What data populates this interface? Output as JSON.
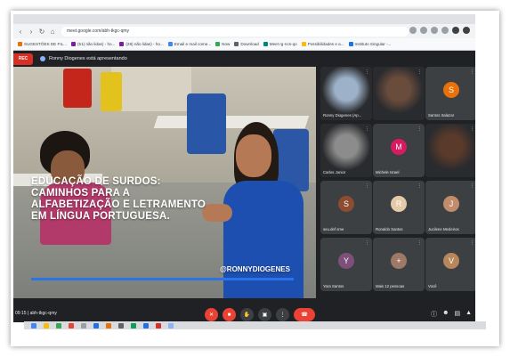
{
  "browser": {
    "url": "meet.google.com/abh-tkgc-qmy",
    "bookmarks": [
      {
        "label": "SUGESTÕES DE FIL...",
        "color": "#e8710a"
      },
      {
        "label": "(51) não lidas) - ho...",
        "color": "#7b1fa2"
      },
      {
        "label": "(28) não lidas) - ho...",
        "color": "#7b1fa2"
      },
      {
        "label": "Email e mail come...",
        "color": "#4285f4"
      },
      {
        "label": "Now",
        "color": "#34a853"
      },
      {
        "label": "Download",
        "color": "#5f6368"
      },
      {
        "label": "Meet rg-ncs-qo",
        "color": "#00897b"
      },
      {
        "label": "Possibilidades e a...",
        "color": "#fbbc04"
      },
      {
        "label": "Instituto Singular -...",
        "color": "#1a73e8"
      }
    ]
  },
  "presentation": {
    "rec_label": "REC",
    "presenter_text": "Ronny Diogenes está apresentando"
  },
  "slide": {
    "title_lines": [
      "EDUCAÇÃO DE SURDOS:",
      "CAMINHOS PARA A",
      "ALFABETIZAÇÃO E LETRAMENTO",
      "EM LÍNGUA PORTUGUESA."
    ],
    "handle": "@RONNYDIOGENES"
  },
  "participants": [
    {
      "name": "Ronny Diogenes (Ap...",
      "type": "photo",
      "color": "#9db2c8",
      "initial": ""
    },
    {
      "name": "",
      "type": "photo",
      "color": "#6a4c3c",
      "initial": ""
    },
    {
      "name": "Santos Salazar",
      "type": "avatar",
      "color": "#e8710a",
      "initial": "S"
    },
    {
      "name": "Carlos Junior",
      "type": "photo",
      "color": "#8c8c8c",
      "initial": ""
    },
    {
      "name": "Michele Israel",
      "type": "avatar",
      "color": "#d81b60",
      "initial": "M"
    },
    {
      "name": "",
      "type": "photo",
      "color": "#5a3a2a",
      "initial": ""
    },
    {
      "name": "seu.def sme",
      "type": "avatar",
      "color": "#8d4b2f",
      "initial": "S"
    },
    {
      "name": "Ronaldo Santos",
      "type": "avatar",
      "color": "#e6c9a8",
      "initial": "R"
    },
    {
      "name": "Jucilene Medeiros",
      "type": "avatar",
      "color": "#c28b6a",
      "initial": "J"
    },
    {
      "name": "Yara Santos",
      "type": "avatar",
      "color": "#7e4f7a",
      "initial": "Y"
    },
    {
      "name": "Mais 12 pessoas",
      "type": "avatar",
      "color": "#a07866",
      "initial": "+"
    },
    {
      "name": "Você",
      "type": "avatar",
      "color": "#b8865b",
      "initial": "V"
    }
  ],
  "toolbar": {
    "meeting_info": "09:15 | abh-tkgc-qmy",
    "controls": [
      "mic-off",
      "camera-off",
      "raise-hand",
      "present",
      "more",
      "leave"
    ]
  },
  "taskbar": {
    "icon_colors": [
      "#4285f4",
      "#fbbc04",
      "#34a853",
      "#ea4335",
      "#9aa0a6",
      "#1a73e8",
      "#e8710a",
      "#5f6368",
      "#0f9d58",
      "#1a73e8",
      "#d93025",
      "#8ab4f8"
    ]
  }
}
